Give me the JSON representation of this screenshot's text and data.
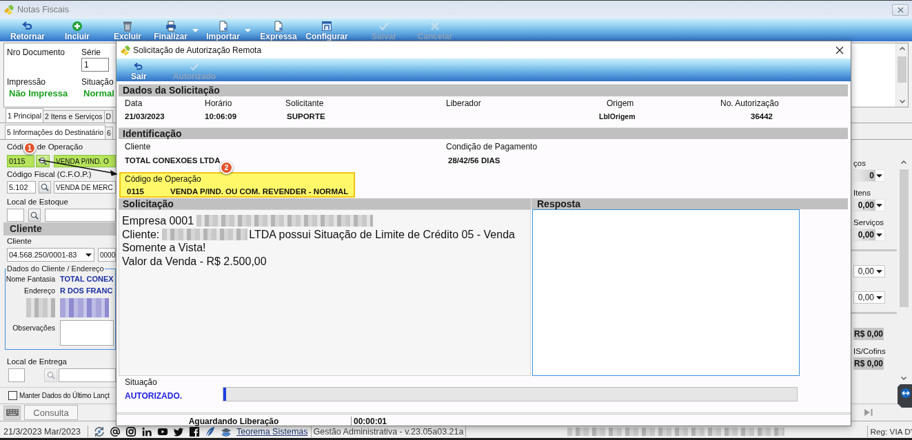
{
  "window": {
    "title": "Notas Fiscais"
  },
  "toolbar": [
    {
      "label": "Retornar",
      "disabled": false,
      "dropdown": false
    },
    {
      "label": "Incluir",
      "disabled": false,
      "dropdown": false
    },
    {
      "label": "Excluir",
      "disabled": false,
      "dropdown": false
    },
    {
      "label": "Finalizar",
      "disabled": false,
      "dropdown": true
    },
    {
      "label": "Importar",
      "disabled": false,
      "dropdown": true
    },
    {
      "label": "Expressa",
      "disabled": false,
      "dropdown": false
    },
    {
      "label": "Configurar",
      "disabled": false,
      "dropdown": false
    },
    {
      "label": "Salvar",
      "disabled": true,
      "dropdown": false
    },
    {
      "label": "Cancelar",
      "disabled": true,
      "dropdown": false
    }
  ],
  "document": {
    "number_label": "Nro Documento",
    "series_label": "Série",
    "series": "1",
    "print_label": "Impressão",
    "print_status": "Não Impressa",
    "status_label": "Situação",
    "status": "Normal"
  },
  "main_tabs": [
    {
      "label": "1 Principal",
      "selected": true
    },
    {
      "label": "2 Itens e Serviços",
      "selected": false
    },
    {
      "label": "D",
      "selected": false
    }
  ],
  "sub_tabs": [
    {
      "label": "5 Informações do Destinatário",
      "selected": true
    },
    {
      "label": "6",
      "selected": false
    }
  ],
  "operation": {
    "label": "Códi",
    "label_rest": "de Operação",
    "code": "0115",
    "description": "VENDA P/IND. O",
    "highlighted": true
  },
  "fiscal_code": {
    "label": "Código Fiscal (C.F.O.P.)",
    "code": "5.102",
    "description": "VENDA DE MERC"
  },
  "stock_location": {
    "label": "Local de Estoque"
  },
  "client": {
    "section_title": "Cliente",
    "label": "Cliente",
    "document": "04.568.250/0001-83",
    "code": "0000"
  },
  "client_details": {
    "title": "Dados do Cliente / Endereço",
    "trade_name_label": "Nome Fantasia",
    "trade_name": "TOTAL CONEX",
    "address_label": "Endereço",
    "address": "R DOS FRANC",
    "redacted": true,
    "notes_label": "Observações"
  },
  "delivery_location": {
    "label": "Local de Entrega"
  },
  "keep_data": {
    "label": "Manter Dados do Último Lançt",
    "checked": false
  },
  "bottom_tabs": [
    {
      "label": "Consulta"
    }
  ],
  "totals_panel": {
    "groups": [
      {
        "items": [
          {
            "label": "ços",
            "value": "0",
            "kind": "summary"
          },
          {
            "label": "Itens",
            "value": "0,00",
            "kind": "summary"
          },
          {
            "label": "Serviços",
            "value": "0,00",
            "kind": "summary"
          }
        ]
      },
      {
        "items": [
          {
            "value": "0,00",
            "kind": "dropdown"
          },
          {
            "value": "0,00",
            "kind": "dropdown"
          }
        ]
      },
      {
        "items": [
          {
            "value": "R$ 0,00",
            "kind": "total"
          },
          {
            "label": "IS/Cofins",
            "value": "R$ 0,00",
            "kind": "total"
          }
        ]
      }
    ]
  },
  "dialog": {
    "title": "Solicitação de Autorização Remota",
    "toolbar": [
      {
        "label": "Sair",
        "disabled": false
      },
      {
        "label": "Autorizado",
        "disabled": true
      }
    ],
    "request_data": {
      "title": "Dados da Solicitação",
      "fields": [
        {
          "label": "Data",
          "value": "21/03/2023"
        },
        {
          "label": "Horário",
          "value": "10:06:09"
        },
        {
          "label": "Solicitante",
          "value": "SUPORTE"
        },
        {
          "label": "Liberador"
        },
        {
          "label": "Origem",
          "value": "LblOrigem"
        },
        {
          "label": "No. Autorização",
          "value": "36442"
        }
      ]
    },
    "identification": {
      "title": "Identificação",
      "client_label": "Cliente",
      "client": "TOTAL CONEXOES LTDA",
      "payment_label": "Condição de Pagamento",
      "payment": "28/42/56 DIAS",
      "operation": {
        "label": "Código de Operação",
        "code": "0115",
        "description": "VENDA P/IND. OU COM. REVENDER - NORMAL",
        "highlighted": true
      }
    },
    "request": {
      "title": "Solicitação",
      "lines": [
        {
          "text": "Empresa 0001",
          "redacted": true
        },
        {
          "text": "Cliente:",
          "redacted": true,
          "continuation": "LTDA possui Situação de Limite de Crédito 05 - Venda"
        },
        {
          "text": "Somente a Vista!"
        },
        {
          "text": "Valor da Venda - R$ 2.500,00"
        }
      ]
    },
    "response": {
      "title": "Resposta"
    },
    "status": {
      "label": "Situação",
      "value": "AUTORIZADO.",
      "level": 0.005
    },
    "footer": {
      "status": "Aguardando Liberação",
      "elapsed": "00:00:01"
    }
  },
  "annotations": [
    {
      "number": "1"
    },
    {
      "number": "2"
    }
  ],
  "status_bar": {
    "date": "21/3/2023 Mar/2023",
    "company_link": "Teorema Sistemas",
    "version": "Gestão Administrativa - v.23.05a03.21a",
    "redacted": true,
    "register": "Reg: VIA D'"
  }
}
